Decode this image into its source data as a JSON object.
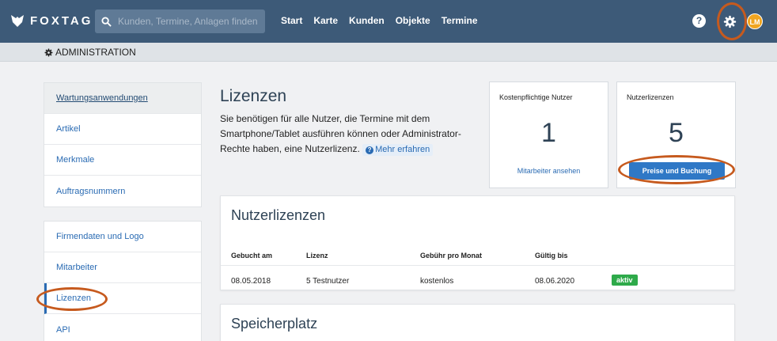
{
  "header": {
    "logo_text": "FOXTAG",
    "search_placeholder": "Kunden, Termine, Anlagen finden",
    "nav": [
      "Start",
      "Karte",
      "Kunden",
      "Objekte",
      "Termine"
    ],
    "help_label": "?",
    "avatar_initials": "LM",
    "accent_color": "#3d5a78",
    "highlight_ring_color": "#c65a1e"
  },
  "subheader": {
    "title": "ADMINISTRATION",
    "icon": "gear-icon"
  },
  "sidebar": {
    "group1": [
      {
        "label": "Wartungsanwendungen"
      },
      {
        "label": "Artikel"
      },
      {
        "label": "Merkmale"
      },
      {
        "label": "Auftragsnummern"
      }
    ],
    "group2": [
      {
        "label": "Firmendaten und Logo"
      },
      {
        "label": "Mitarbeiter"
      },
      {
        "label": "Lizenzen"
      },
      {
        "label": "API"
      }
    ]
  },
  "main": {
    "title": "Lizenzen",
    "description": "Sie benötigen für alle Nutzer, die Termine mit dem Smartphone/Tablet ausführen können oder Administrator-Rechte haben, eine Nutzerlizenz.",
    "more_link": "Mehr erfahren",
    "cards": {
      "paid_users": {
        "label": "Kostenpflichtige Nutzer",
        "value": "1",
        "link": "Mitarbeiter ansehen"
      },
      "user_licenses": {
        "label": "Nutzerlizenzen",
        "value": "5",
        "button": "Preise und Buchung"
      }
    },
    "licenses_panel": {
      "title": "Nutzerlizenzen",
      "columns": [
        "Gebucht am",
        "Lizenz",
        "Gebühr pro Monat",
        "Gültig bis"
      ],
      "rows": [
        {
          "booked": "08.05.2018",
          "license": "5 Testnutzer",
          "fee": "kostenlos",
          "valid_until": "08.06.2020",
          "status": "aktiv"
        }
      ],
      "status_color": "#2eaa4a"
    },
    "storage_panel": {
      "title": "Speicherplatz"
    }
  }
}
